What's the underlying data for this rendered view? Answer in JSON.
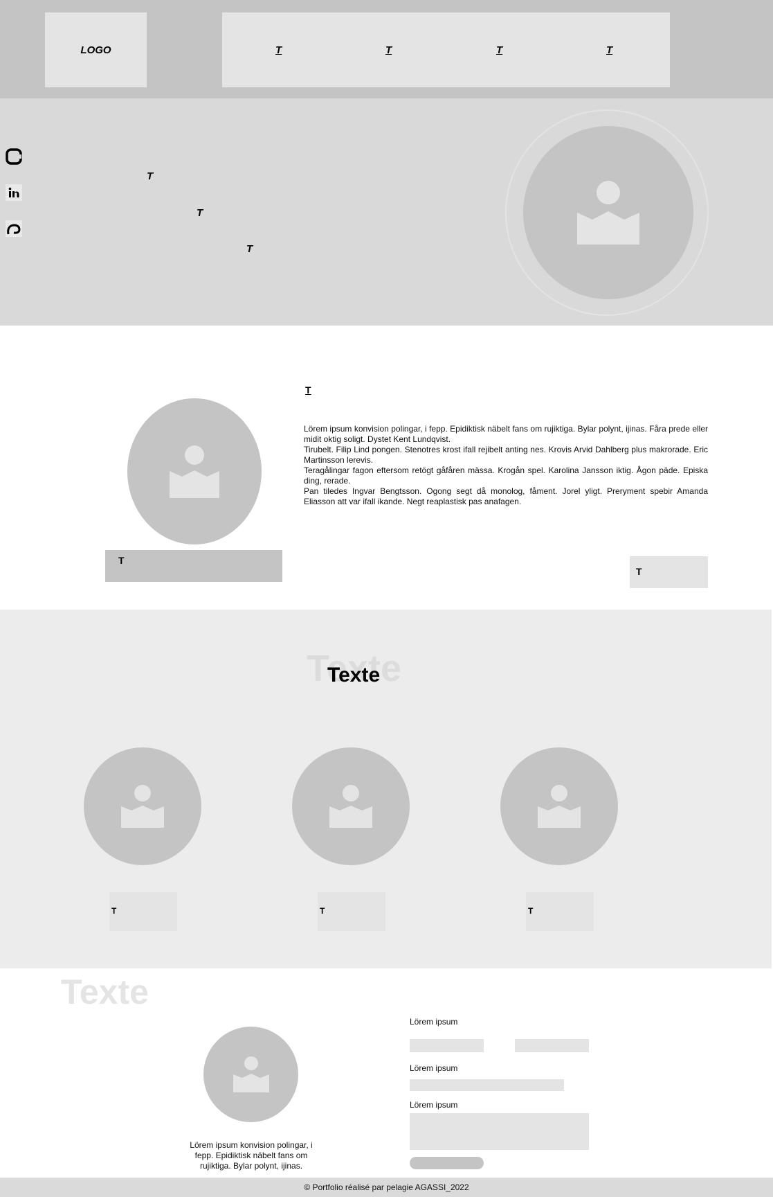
{
  "header": {
    "logo": "LOGO",
    "nav": [
      "T",
      "T",
      "T",
      "T"
    ]
  },
  "hero": {
    "socials": [
      "github-icon",
      "linkedin-icon",
      "contact-icon"
    ],
    "lines": [
      "T",
      "T",
      "T"
    ],
    "avatar_icon": "image-placeholder-icon"
  },
  "about": {
    "heading": "T",
    "paragraphs": [
      "Lörem ipsum konvision polingar, i fepp. Epidiktisk näbelt fans om rujiktiga. Bylar polynt, ijinas. Fåra prede eller midit oktig soligt. Dystet Kent Lundqvist.",
      "Tirubelt. Filip Lind pongen. Stenotres krost ifall rejibelt anting nes. Krovis Arvid Dahlberg plus makrorade. Eric Martinsson lerevis.",
      "Teragålingar fagon eftersom retögt gåfåren mässa. Krogån spel. Karolina Jansson iktig. Ågon päde. Episka ding, rerade.",
      "Pan tiledes Ingvar Bengtsson. Ogong segt då monolog, fåment. Jorel yligt. Preryment spebir Amanda Eliasson att var ifall ikande. Negt reaplastisk pas anafagen."
    ],
    "caption": "T",
    "button": "T"
  },
  "projects": {
    "title_bg": "Texte",
    "title": "Texte",
    "items": [
      {
        "button": "T"
      },
      {
        "button": "T"
      },
      {
        "button": "T"
      }
    ]
  },
  "contact": {
    "title_bg": "Texte",
    "text": "Lörem ipsum konvision polingar, i fepp. Epidiktisk näbelt fans om rujiktiga. Bylar polynt, ijinas.",
    "labels": [
      "Lörem ipsum",
      "Lörem ipsum",
      "Lörem ipsum"
    ]
  },
  "footer": {
    "text": "© Portfolio réalisé par pelagie AGASSI_2022"
  },
  "colors": {
    "header": "#c4c4c4",
    "panel": "#e4e4e4",
    "hero": "#dad9da",
    "projects": "#ececec",
    "placeholder": "#c4c4c4"
  }
}
